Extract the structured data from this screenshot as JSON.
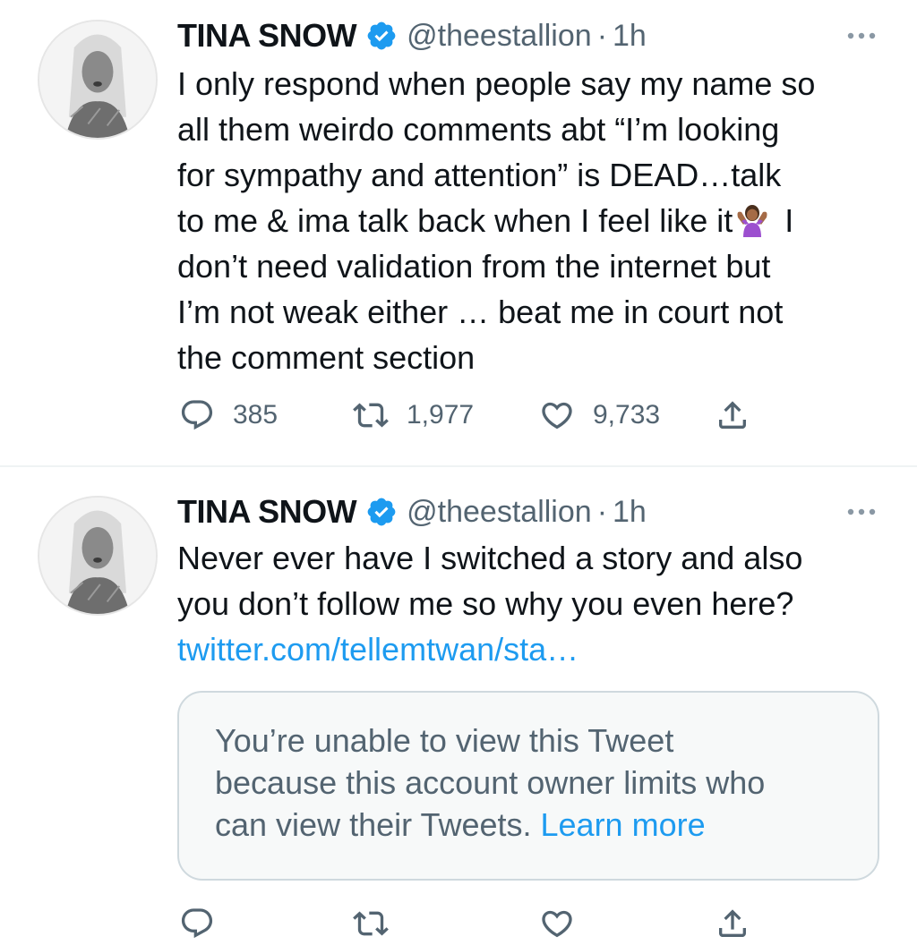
{
  "colors": {
    "text": "#0f1419",
    "secondary": "#536471",
    "link": "#1d9bf0",
    "verified": "#1d9bf0",
    "divider": "#eff3f4"
  },
  "tweets": [
    {
      "author": {
        "name": "TINA SNOW",
        "handle": "@theestallion",
        "separator": "·",
        "time": "1h",
        "avatar_icon": "avatar-photo",
        "verified_icon": "verified-badge-icon"
      },
      "text_lines": [
        "I only respond when people say my name so",
        "all them weirdo comments abt “I’m looking",
        "for sympathy and attention” is DEAD…talk",
        "to me & ima talk back when I feel like it",
        " I",
        "don’t need validation from the internet but",
        "I’m not weak either … beat me in court not",
        "the comment section"
      ],
      "emoji_icon": "woman-shrugging-emoji",
      "actions": {
        "reply_count": "385",
        "retweet_count": "1,977",
        "like_count": "9,733"
      }
    },
    {
      "author": {
        "name": "TINA SNOW",
        "handle": "@theestallion",
        "separator": "·",
        "time": "1h",
        "avatar_icon": "avatar-photo",
        "verified_icon": "verified-badge-icon"
      },
      "text_lines": [
        "Never ever have I switched a story and also",
        "you don’t follow me so why you even here?"
      ],
      "link": "twitter.com/tellemtwan/sta…",
      "quote": {
        "lines": [
          "You’re unable to view this Tweet",
          "because this account owner limits who",
          "can view their Tweets. "
        ],
        "learn_more": "Learn more"
      }
    }
  ]
}
